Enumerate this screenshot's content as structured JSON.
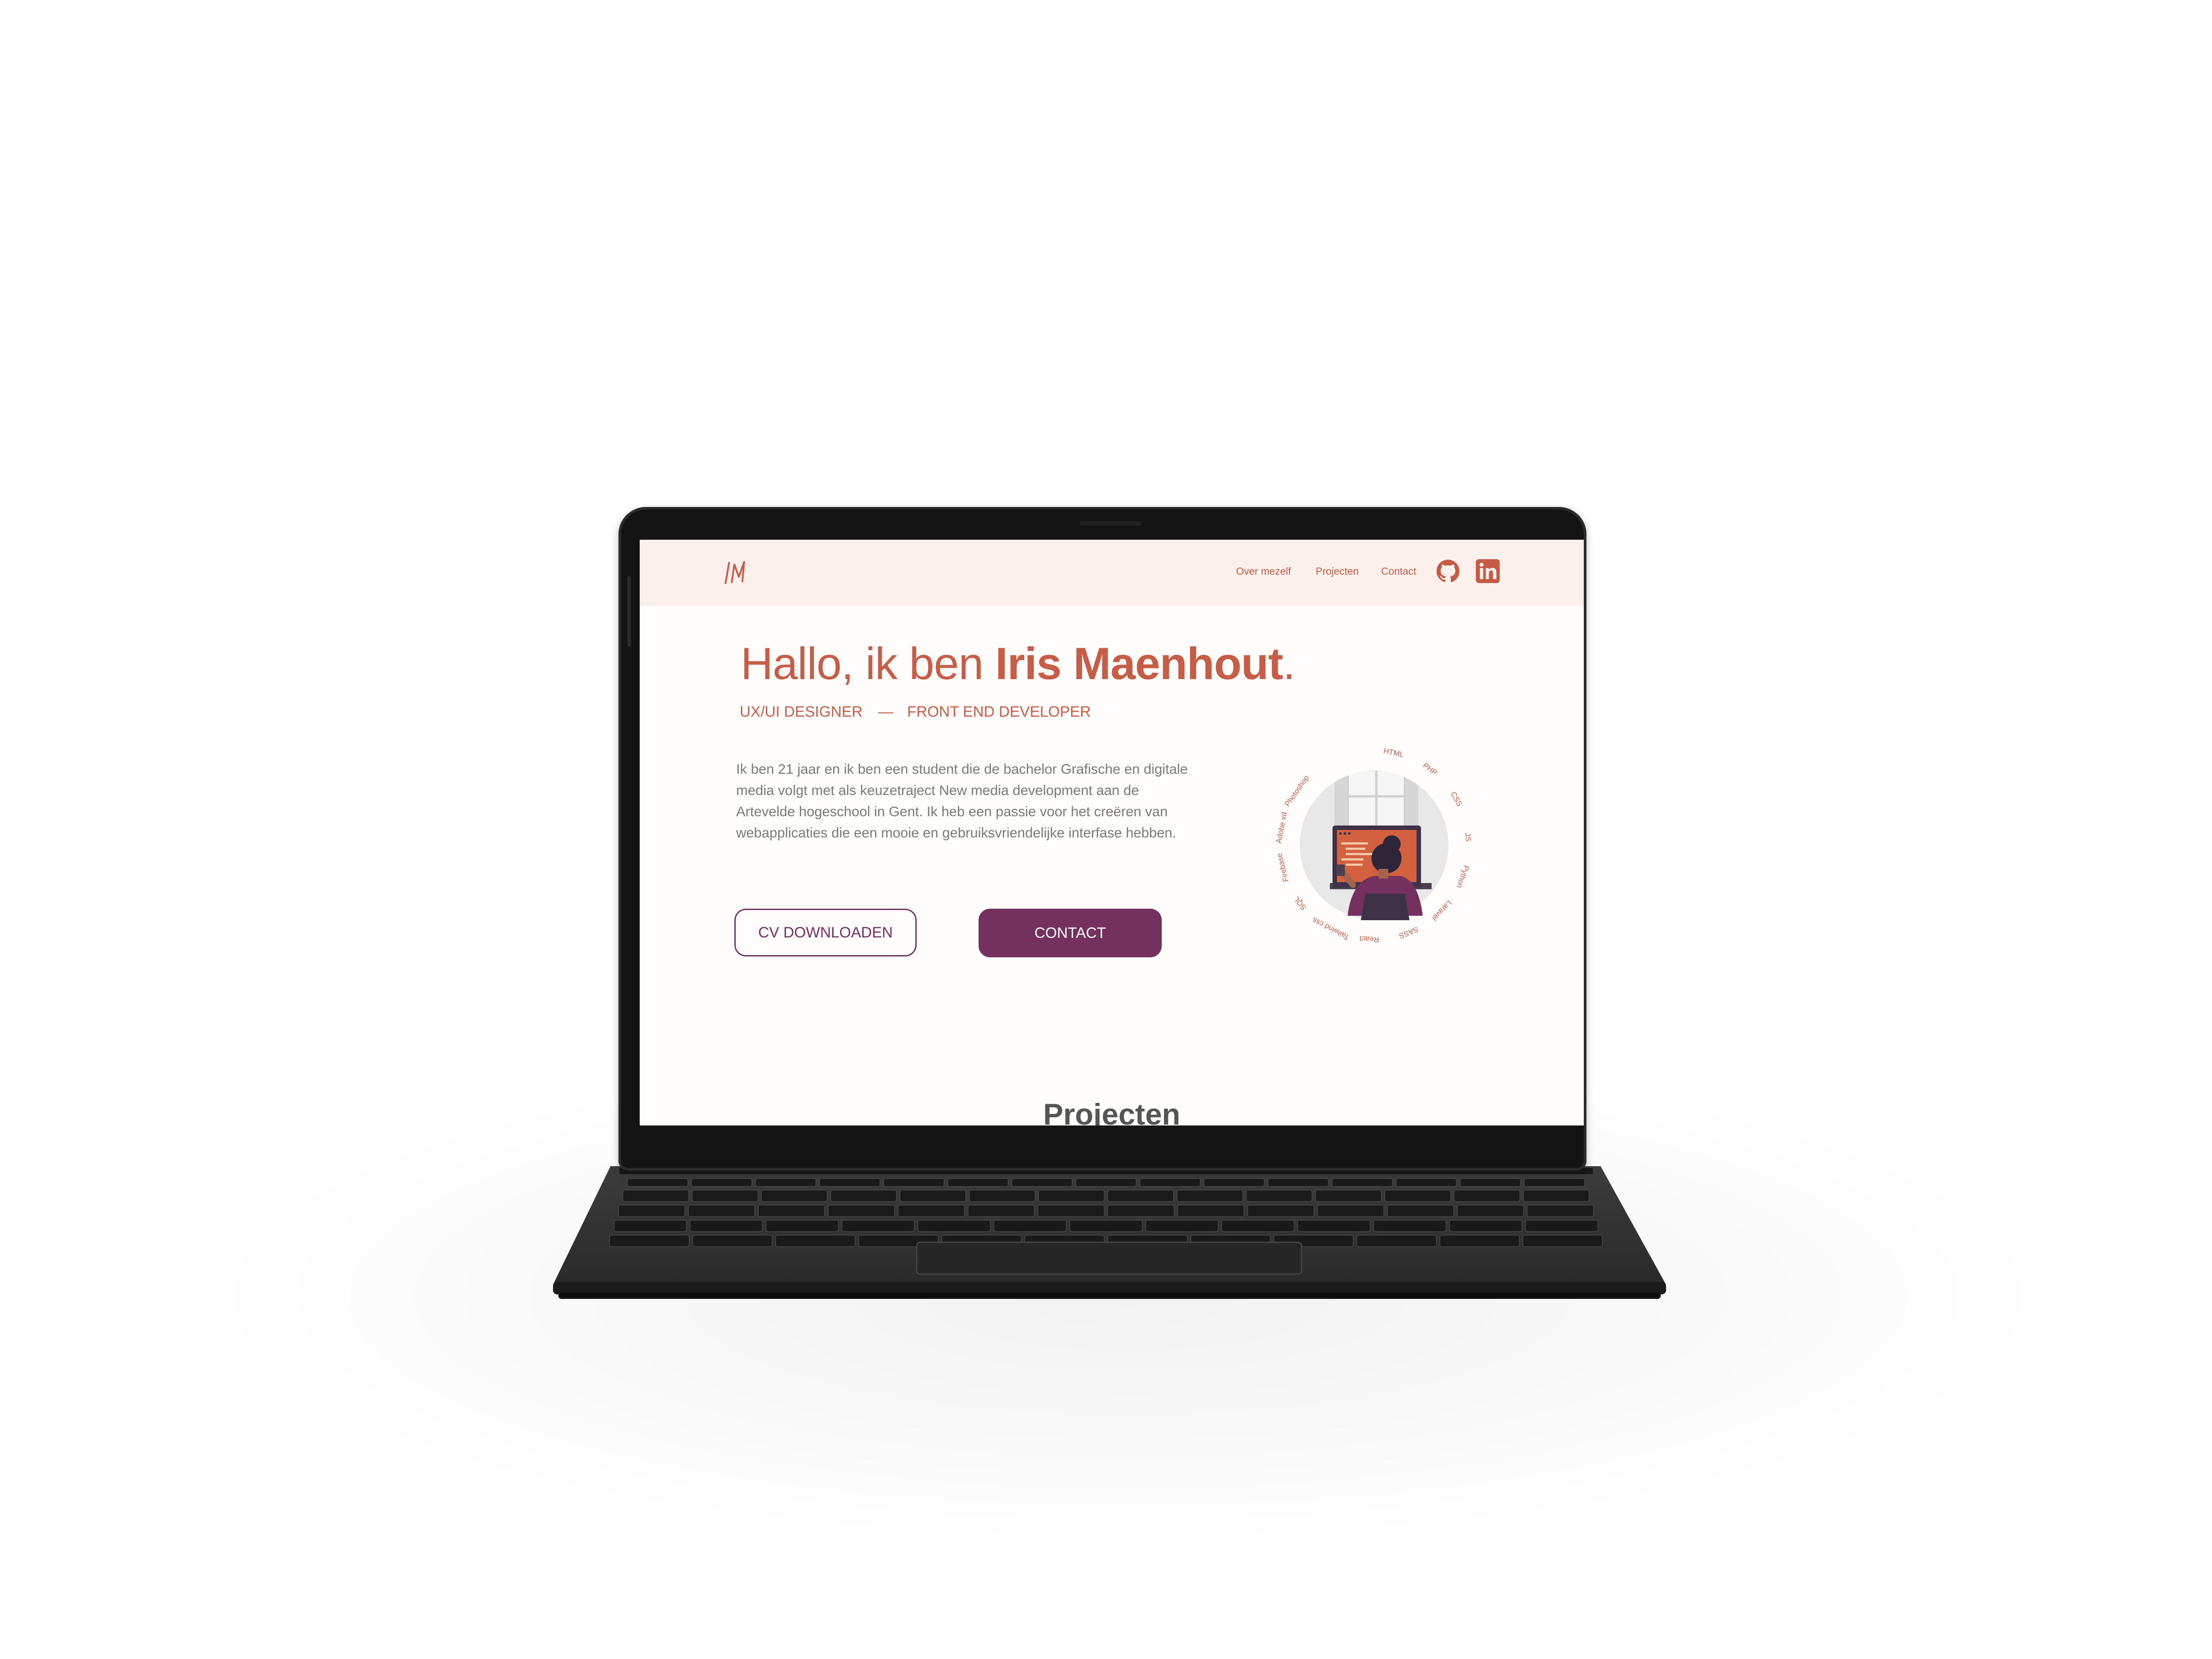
{
  "nav": {
    "logo_text": "IM",
    "links": [
      "Over mezelf",
      "Projecten",
      "Contact"
    ],
    "icons": [
      "github-icon",
      "linkedin-icon"
    ]
  },
  "hero": {
    "greeting": "Hallo, ik ben ",
    "name": "Iris Maenhout",
    "end": ".",
    "role_1": "UX/UI DESIGNER",
    "role_sep": "—",
    "role_2": "FRONT END DEVELOPER",
    "intro": "Ik ben 21 jaar en ik ben een student die de bachelor Grafische en digitale media volgt met als keuzetraject New media development aan de Artevelde hogeschool in Gent. Ik heb een passie voor het creëren van webapplicaties die een mooie en gebruiksvriendelijke interfase hebben.",
    "btn_cv": "CV DOWNLOADEN",
    "btn_contact": "CONTACT"
  },
  "skills": [
    "HTML",
    "PHP",
    "CSS",
    "JS",
    "Python",
    "Laravel",
    "SASS",
    "React",
    "Tailwind css",
    "SQL",
    "Firebase",
    "Adobe xd",
    "Photoshop"
  ],
  "section": {
    "title": "Projecten"
  },
  "colors": {
    "accent": "#c75d46",
    "primary": "#74305e",
    "nav_bg": "#fcf0ed",
    "page_bg": "#fffcfc"
  }
}
